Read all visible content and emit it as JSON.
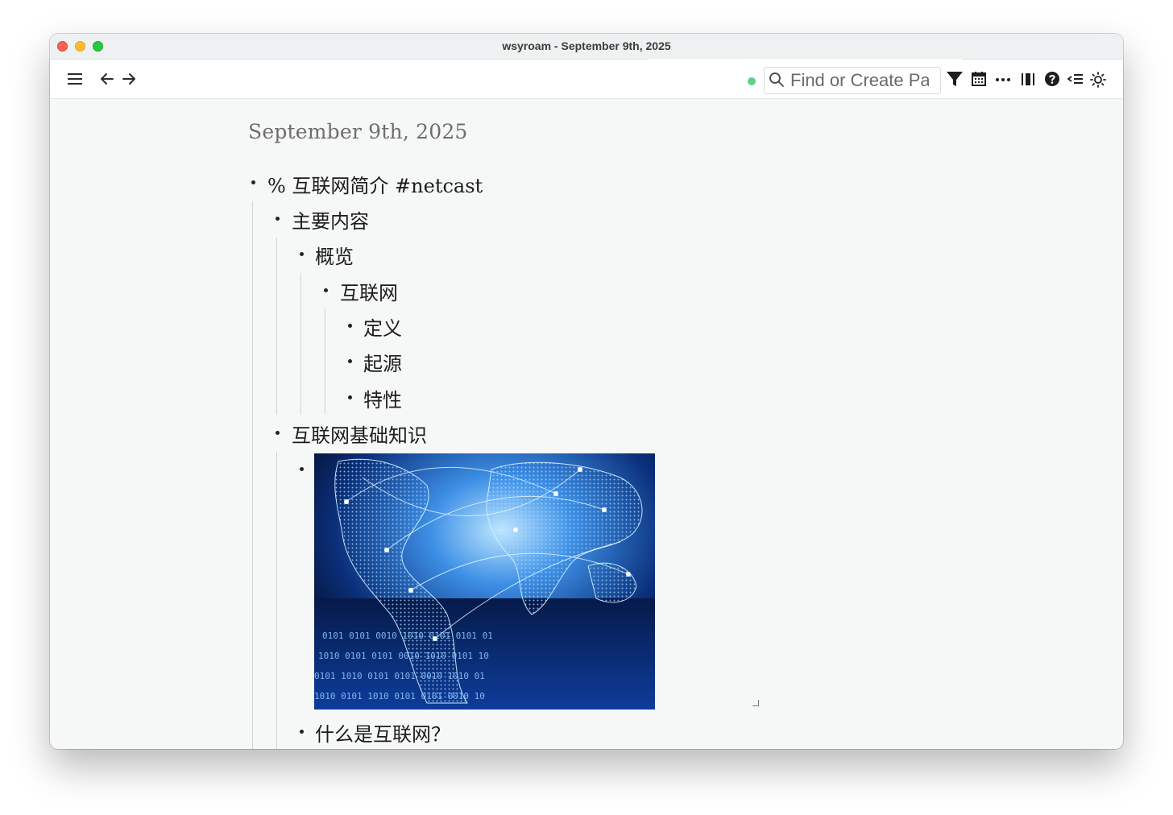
{
  "window": {
    "title": "wsyroam - September 9th, 2025"
  },
  "toolbar": {
    "menu_icon": "hamburger-icon",
    "back_icon": "arrow-left-icon",
    "forward_icon": "arrow-right-icon",
    "sync_status_color": "#5fd182",
    "search": {
      "placeholder": "Find or Create Page",
      "value": ""
    },
    "right_icons": [
      "filter-icon",
      "calendar-icon",
      "more-icon",
      "sidebar-icon",
      "help-icon",
      "outline-icon",
      "theme-icon"
    ]
  },
  "page": {
    "title": "September 9th, 2025",
    "blocks": [
      {
        "text": "% 互联网简介 #netcast"
      },
      {
        "text": "主要内容"
      },
      {
        "text": "概览"
      },
      {
        "text": "互联网"
      },
      {
        "text": "定义"
      },
      {
        "text": "起源"
      },
      {
        "text": "特性"
      },
      {
        "text": "互联网基础知识"
      },
      {
        "text": "",
        "image": "world-network-globe-image"
      },
      {
        "text": "什么是互联网？"
      }
    ]
  },
  "colors": {
    "accent": "#5fd182",
    "background": "#f6f7f7",
    "title": "#6d6d6d",
    "text": "#1c1c1c"
  }
}
